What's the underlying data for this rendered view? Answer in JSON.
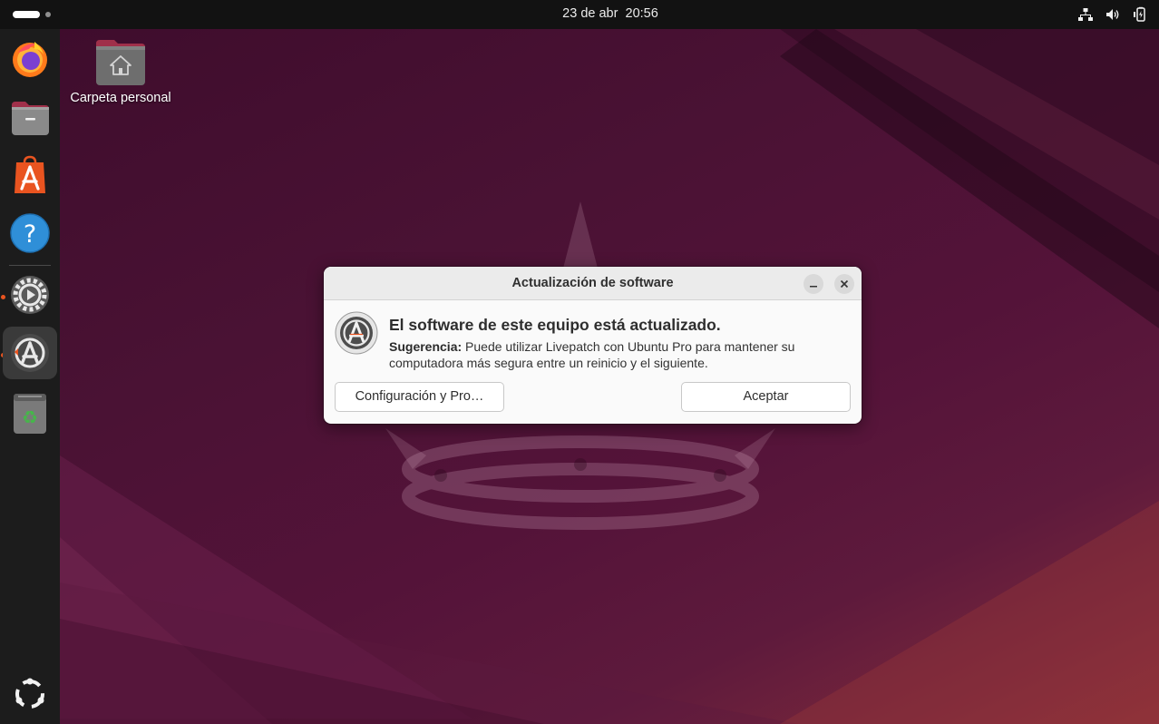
{
  "topbar": {
    "date": "23 de abr",
    "time": "20:56",
    "tray_icons": [
      "network-icon",
      "volume-icon",
      "power-icon"
    ]
  },
  "desktop": {
    "folder_label": "Carpeta personal"
  },
  "dock": {
    "items": [
      "firefox-icon",
      "files-icon",
      "app-center-icon",
      "help-icon",
      "settings-icon",
      "software-updater-icon",
      "trash-icon",
      "show-apps-icon"
    ],
    "accent_color": "#e95420"
  },
  "dialog": {
    "title": "Actualización de software",
    "heading": "El software de este equipo está actualizado.",
    "hint_label": "Sugerencia:",
    "hint_text": " Puede utilizar Livepatch con Ubuntu Pro para mantener su computadora más segura entre un reinicio y el siguiente.",
    "settings_button": "Configuración y Pro…",
    "accept_button": "Aceptar"
  }
}
